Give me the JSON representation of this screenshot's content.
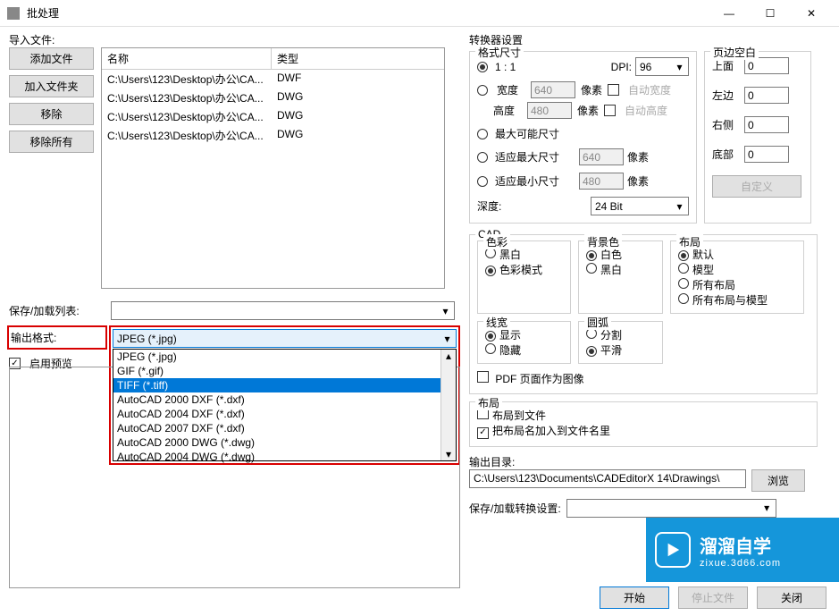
{
  "window": {
    "title": "批处理"
  },
  "import": {
    "label": "导入文件:",
    "buttons": {
      "add_file": "添加文件",
      "add_folder": "加入文件夹",
      "remove": "移除",
      "remove_all": "移除所有"
    },
    "list_headers": {
      "name": "名称",
      "type": "类型"
    },
    "files": [
      {
        "name": "C:\\Users\\123\\Desktop\\办公\\CA...",
        "type": "DWF"
      },
      {
        "name": "C:\\Users\\123\\Desktop\\办公\\CA...",
        "type": "DWG"
      },
      {
        "name": "C:\\Users\\123\\Desktop\\办公\\CA...",
        "type": "DWG"
      },
      {
        "name": "C:\\Users\\123\\Desktop\\办公\\CA...",
        "type": "DWG"
      }
    ]
  },
  "save_load_list_label": "保存/加载列表:",
  "output_format": {
    "label": "输出格式:",
    "value": "JPEG (*.jpg)",
    "options": [
      "JPEG (*.jpg)",
      "GIF (*.gif)",
      "TIFF (*.tiff)",
      "AutoCAD 2000 DXF (*.dxf)",
      "AutoCAD 2004 DXF (*.dxf)",
      "AutoCAD 2007 DXF (*.dxf)",
      "AutoCAD 2000 DWG (*.dwg)",
      "AutoCAD 2004 DWG (*.dwg)"
    ],
    "selected_index": 2
  },
  "enable_preview": "启用预览",
  "converter": {
    "title": "转换器设置",
    "format_size": {
      "title": "格式尺寸",
      "one_to_one": "1 : 1",
      "dpi_label": "DPI:",
      "dpi_value": "96",
      "width_label": "宽度",
      "width_value": "640",
      "height_label": "高度",
      "height_value": "480",
      "pixel": "像素",
      "auto_width": "自动宽度",
      "auto_height": "自动高度",
      "max_possible": "最大可能尺寸",
      "fit_max": "适应最大尺寸",
      "fit_max_value": "640",
      "fit_min": "适应最小尺寸",
      "fit_min_value": "480",
      "depth_label": "深度:",
      "depth_value": "24 Bit"
    },
    "margins": {
      "title": "页边空白",
      "top": "上面",
      "top_v": "0",
      "left": "左边",
      "left_v": "0",
      "right": "右侧",
      "right_v": "0",
      "bottom": "底部",
      "bottom_v": "0",
      "custom_btn": "自定义"
    },
    "cad": {
      "title": "CAD",
      "color": {
        "title": "色彩",
        "bw": "黑白",
        "color": "色彩模式"
      },
      "bg": {
        "title": "背景色",
        "white": "白色",
        "black": "黑白"
      },
      "layout": {
        "title": "布局",
        "default": "默认",
        "model": "模型",
        "all": "所有布局",
        "all_model": "所有布局与模型"
      },
      "lineweight": {
        "title": "线宽",
        "show": "显示",
        "hide": "隐藏"
      },
      "arc": {
        "title": "圆弧",
        "split": "分割",
        "smooth": "平滑"
      },
      "pdf_as_image": "PDF 页面作为图像"
    },
    "layout_section": {
      "title": "布局",
      "to_file": "布局到文件",
      "add_name": "把布局名加入到文件名里"
    },
    "output_dir": {
      "label": "输出目录:",
      "value": "C:\\Users\\123\\Documents\\CADEditorX 14\\Drawings\\",
      "browse": "浏览"
    },
    "save_load_settings": "保存/加载转换设置:"
  },
  "footer": {
    "start": "开始",
    "stop": "停止文件",
    "close": "关闭"
  },
  "watermark": {
    "brand": "溜溜自学",
    "url": "zixue.3d66.com"
  }
}
